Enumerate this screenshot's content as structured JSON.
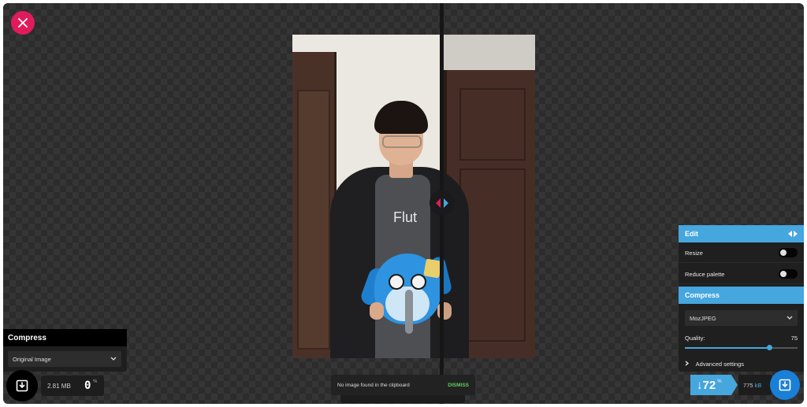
{
  "close_button": {
    "icon": "close-icon"
  },
  "photo": {
    "shirt_text": "Flut"
  },
  "left_panel": {
    "header": "Compress",
    "method": "Original Image",
    "file_size": "2.81 MB",
    "percent": "0",
    "percent_symbol": "%"
  },
  "right_panel": {
    "edit_header": "Edit",
    "resize_label": "Resize",
    "reduce_palette_label": "Reduce palette",
    "compress_header": "Compress",
    "method": "MozJPEG",
    "quality_label": "Quality:",
    "quality_value": "75",
    "quality_level": 0.75,
    "advanced_label": "Advanced settings",
    "savings": "72",
    "savings_arrow": "↓",
    "savings_symbol": "%",
    "output_size": "775",
    "output_unit": "kB"
  },
  "snackbar": {
    "message": "No image found in the clipboard",
    "action": "DISMISS"
  },
  "colors": {
    "accent": "#46a6de",
    "close": "#e01b5c",
    "dismiss": "#5ccf60"
  }
}
